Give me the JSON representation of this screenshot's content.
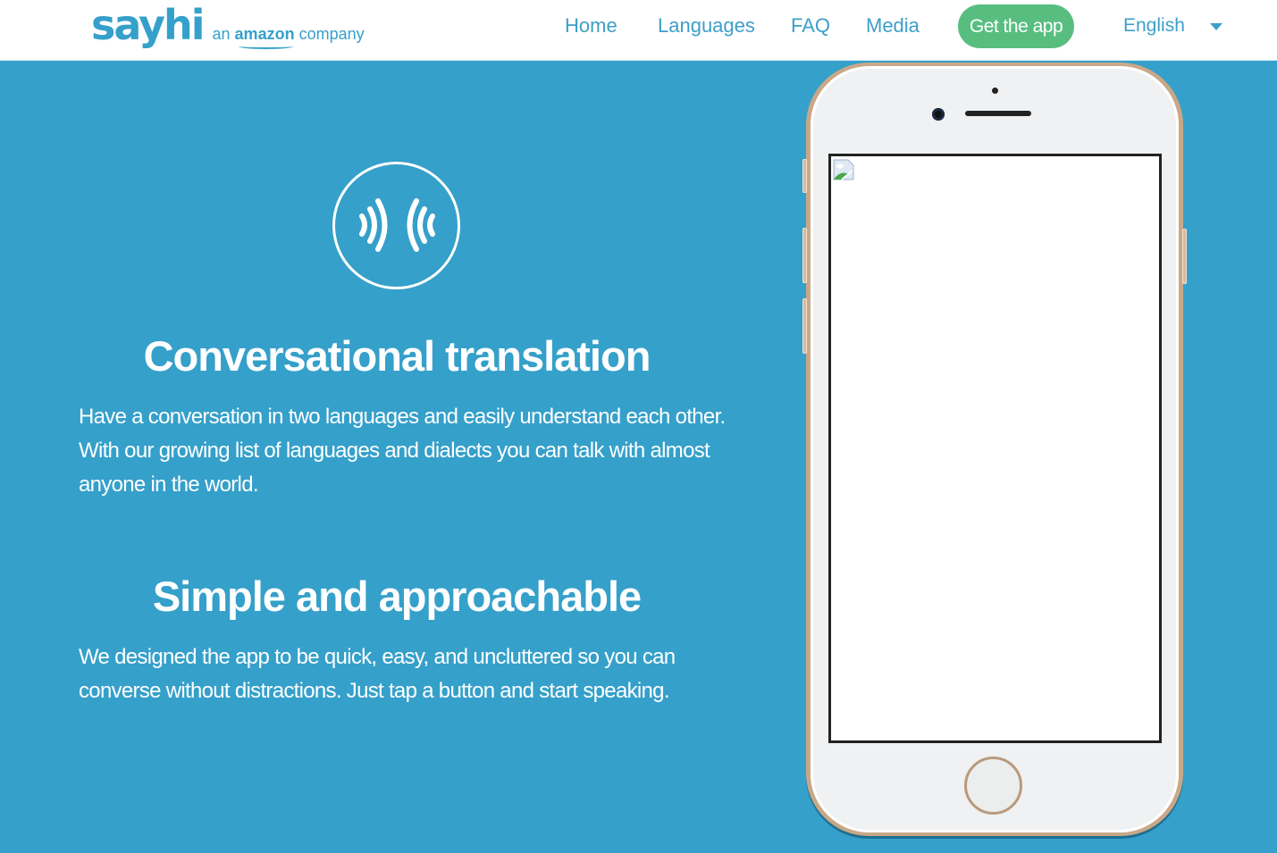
{
  "header": {
    "logo_text": "sayhi",
    "tagline_prefix": "an",
    "tagline_brand": "amazon",
    "tagline_suffix": "company",
    "nav": [
      {
        "label": "Home"
      },
      {
        "label": "Languages"
      },
      {
        "label": "FAQ"
      },
      {
        "label": "Media"
      }
    ],
    "cta_label": "Get the app",
    "language_selected": "English"
  },
  "features": [
    {
      "icon": "sound-waves-icon",
      "title": "Conversational translation",
      "description": "Have a conversation in two languages and easily understand each other. With our growing list of languages and dialects you can talk with almost anyone in the world."
    },
    {
      "title": "Simple and approachable",
      "description": "We designed the app to be quick, easy, and uncluttered so you can converse without distractions. Just tap a button and start speaking."
    }
  ],
  "phone": {
    "screen_image": "broken-image-icon"
  },
  "colors": {
    "brand_blue": "#35a0ca",
    "cta_green": "#58be80",
    "nav_text": "#3d9fc9",
    "phone_gold": "#c9a887"
  }
}
